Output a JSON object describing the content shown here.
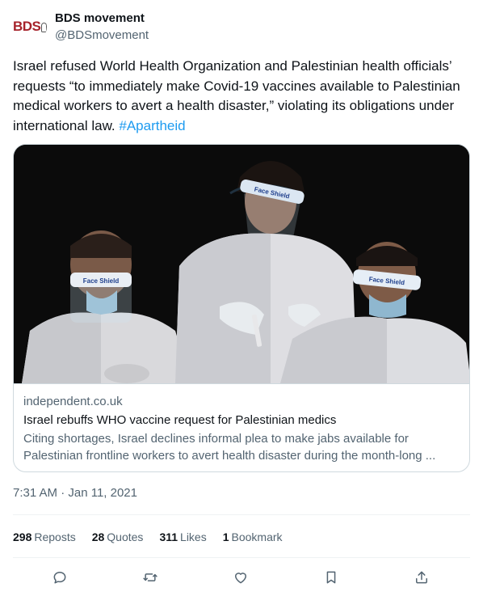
{
  "author": {
    "display_name": "BDS movement",
    "handle": "@BDSmovement",
    "avatar_text": "BDS"
  },
  "tweet": {
    "text": "Israel refused World Health Organization and Palestinian health officials’ requests “to immediately make Covid-19 vaccines available to Palestinian medical workers to avert a health disaster,” violating its obligations under international law.",
    "hashtag": "#Apartheid"
  },
  "card": {
    "image_labels": [
      "Face Shield",
      "Face Shield",
      "Face Shield"
    ],
    "domain": "independent.co.uk",
    "title": "Israel rebuffs WHO vaccine request for Palestinian medics",
    "description": "Citing shortages, Israel declines informal plea to make jabs available for Palestinian frontline workers to avert health disaster during the month-long ..."
  },
  "timestamp": "7:31 AM · Jan 11, 2021",
  "stats": {
    "reposts_count": "298",
    "reposts_label": "Reposts",
    "quotes_count": "28",
    "quotes_label": "Quotes",
    "likes_count": "311",
    "likes_label": "Likes",
    "bookmarks_count": "1",
    "bookmarks_label": "Bookmark"
  },
  "actions": [
    "reply-icon",
    "repost-icon",
    "like-icon",
    "bookmark-icon",
    "share-icon"
  ],
  "colors": {
    "link": "#1d9bf0",
    "secondary_text": "#536471",
    "brand_red": "#a6232b"
  }
}
